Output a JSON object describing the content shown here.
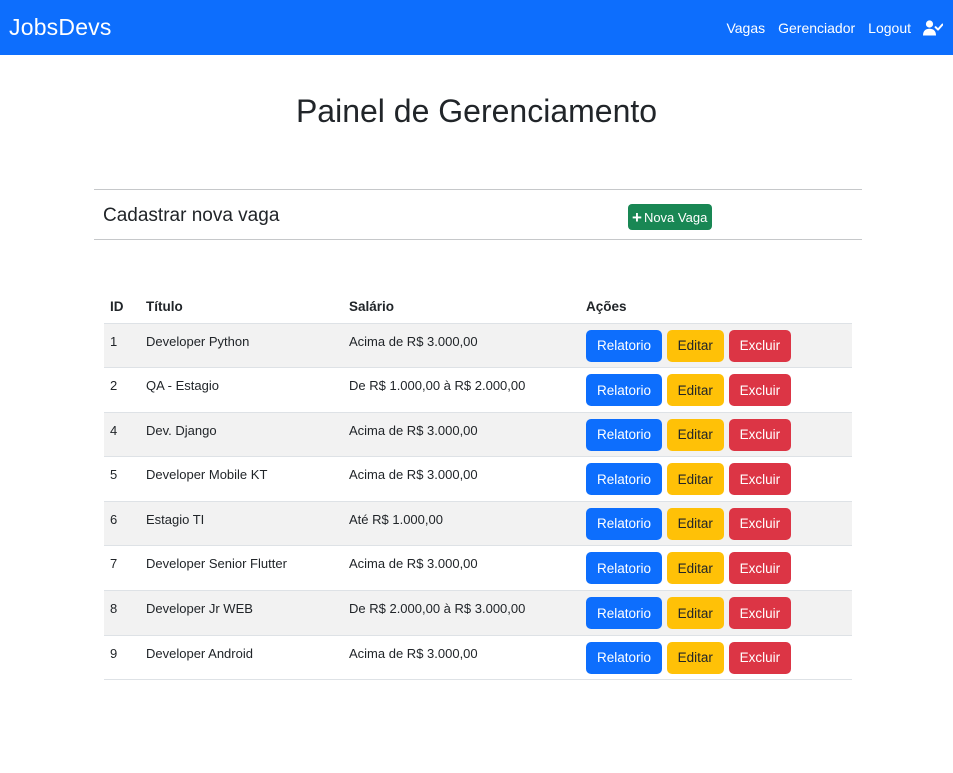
{
  "navbar": {
    "brand": "JobsDevs",
    "links": [
      {
        "label": "Vagas"
      },
      {
        "label": "Gerenciador"
      },
      {
        "label": "Logout"
      }
    ],
    "user_icon": "user-check-icon"
  },
  "page": {
    "title": "Painel de Gerenciamento"
  },
  "create_panel": {
    "title": "Cadastrar nova vaga",
    "button_label": "Nova Vaga",
    "button_icon": "plus-icon"
  },
  "table": {
    "headers": {
      "id": "ID",
      "title": "Título",
      "salary": "Salário",
      "actions": "Ações"
    },
    "actions": {
      "report": "Relatorio",
      "edit": "Editar",
      "delete": "Excluir"
    },
    "rows": [
      {
        "id": "1",
        "title": "Developer Python",
        "salary": "Acima de R$ 3.000,00"
      },
      {
        "id": "2",
        "title": "QA - Estagio",
        "salary": "De R$ 1.000,00 à R$ 2.000,00"
      },
      {
        "id": "4",
        "title": "Dev. Django",
        "salary": "Acima de R$ 3.000,00"
      },
      {
        "id": "5",
        "title": "Developer Mobile KT",
        "salary": "Acima de R$ 3.000,00"
      },
      {
        "id": "6",
        "title": "Estagio TI",
        "salary": "Até R$ 1.000,00"
      },
      {
        "id": "7",
        "title": "Developer Senior Flutter",
        "salary": "Acima de R$ 3.000,00"
      },
      {
        "id": "8",
        "title": "Developer Jr WEB",
        "salary": "De R$ 2.000,00 à R$ 3.000,00"
      },
      {
        "id": "9",
        "title": "Developer Android",
        "salary": "Acima de R$ 3.000,00"
      }
    ]
  },
  "colors": {
    "primary": "#0d6efd",
    "success": "#198754",
    "warning": "#ffc107",
    "danger": "#dc3545"
  }
}
